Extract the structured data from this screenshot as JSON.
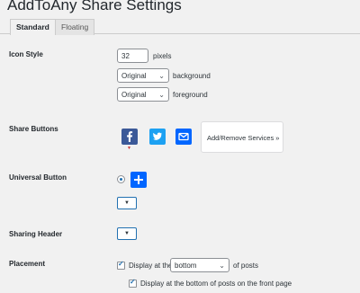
{
  "page_title": "AddToAny Share Settings",
  "tabs": [
    {
      "label": "Standard",
      "active": true
    },
    {
      "label": "Floating",
      "active": false
    }
  ],
  "icon_style": {
    "label": "Icon Style",
    "size_value": "32",
    "size_suffix": "pixels",
    "background_select": "Original",
    "background_suffix": "background",
    "foreground_select": "Original",
    "foreground_suffix": "foreground"
  },
  "share_buttons": {
    "label": "Share Buttons",
    "icons": [
      "facebook-icon",
      "twitter-icon",
      "email-icon"
    ],
    "services_label": "Add/Remove Services »",
    "colors": {
      "facebook": "#3b5998",
      "twitter": "#1da1f2",
      "email": "#0166ff"
    }
  },
  "universal_button": {
    "label": "Universal Button",
    "selected": true,
    "icon": "plus-icon",
    "color": "#0166ff"
  },
  "sharing_header": {
    "label": "Sharing Header"
  },
  "placement": {
    "label": "Placement",
    "display_prefix": "Display at the",
    "position_select": "bottom",
    "display_suffix": "of posts",
    "front_page_label": "Display at the bottom of posts on the front page",
    "display_checked": true,
    "front_page_checked": true
  }
}
